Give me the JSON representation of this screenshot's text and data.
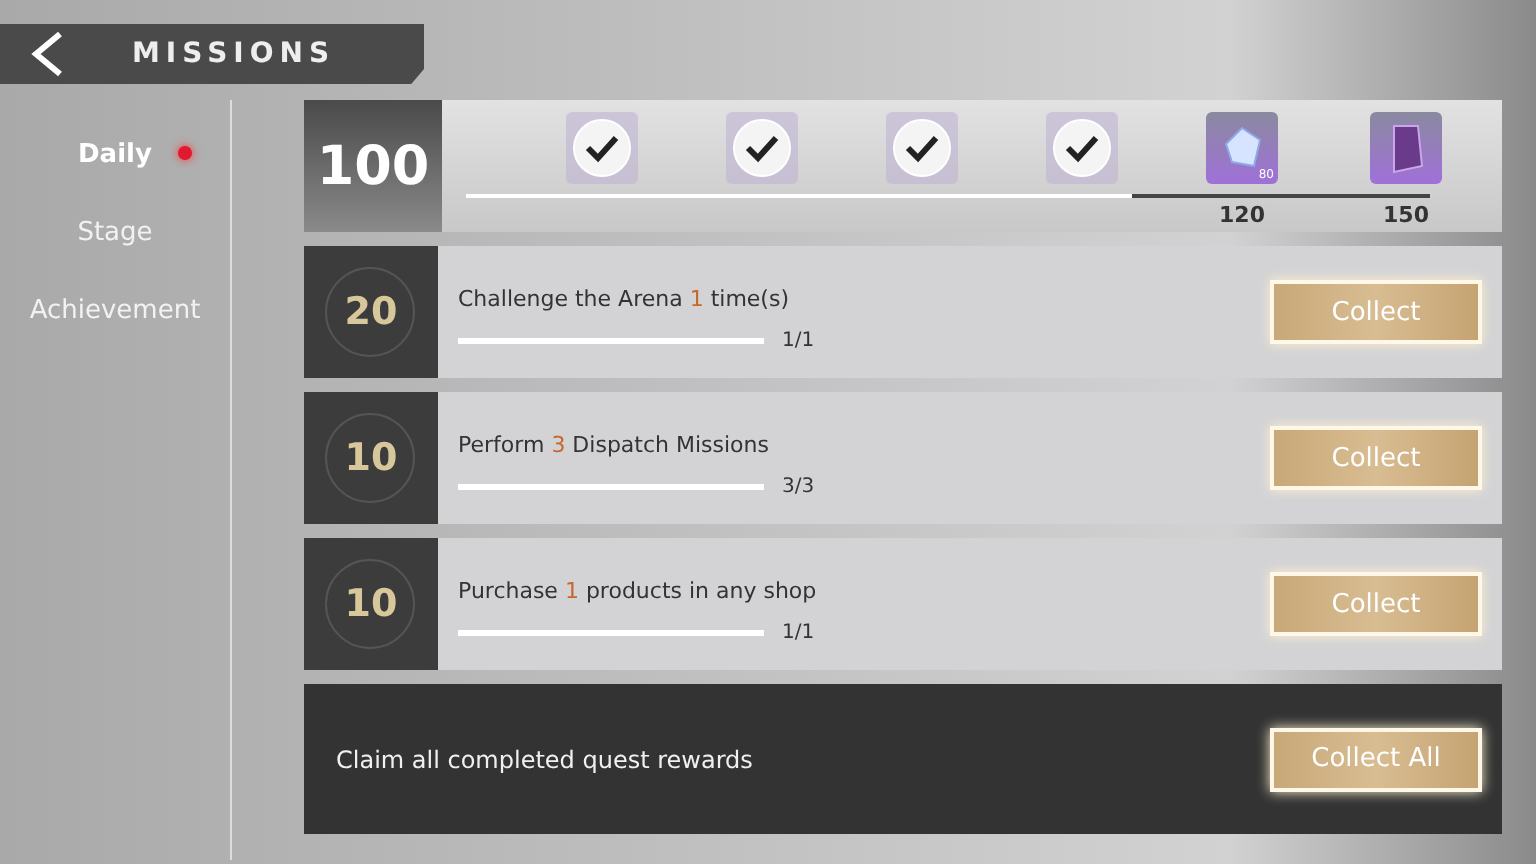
{
  "header": {
    "title": "MISSIONS"
  },
  "tabs": [
    {
      "label": "Daily",
      "selected": true,
      "alert": true
    },
    {
      "label": "Stage",
      "selected": false,
      "alert": false
    },
    {
      "label": "Achievement",
      "selected": false,
      "alert": false
    }
  ],
  "activity": {
    "points": "100",
    "level": 0.69,
    "rewards": [
      {
        "kind": "claimed"
      },
      {
        "kind": "claimed"
      },
      {
        "kind": "claimed"
      },
      {
        "kind": "claimed"
      },
      {
        "kind": "crystal",
        "count": "80",
        "milestone": "120"
      },
      {
        "kind": "scroll",
        "milestone": "150"
      }
    ]
  },
  "missions": [
    {
      "points": "20",
      "text": "Challenge the Arena **1** time(s)",
      "level": 1,
      "progress": "1/1",
      "button": "Collect"
    },
    {
      "points": "10",
      "text": "Perform **3** Dispatch Missions",
      "level": 1,
      "progress": "3/3",
      "button": "Collect"
    },
    {
      "points": "10",
      "text": "Purchase **1** products in any shop",
      "level": 1,
      "progress": "1/1",
      "button": "Collect"
    }
  ],
  "footer": {
    "text": "Claim all completed quest rewards",
    "button": "Collect All"
  }
}
